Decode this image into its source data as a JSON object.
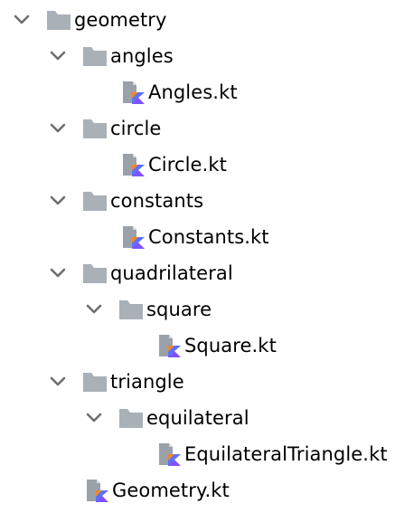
{
  "tree": {
    "root": {
      "label": "geometry",
      "icon": "folder-icon",
      "expanded": true
    },
    "items": [
      {
        "label": "angles",
        "icon": "folder-icon",
        "expanded": true
      },
      {
        "label": "Angles.kt",
        "icon": "kotlin-file-icon"
      },
      {
        "label": "circle",
        "icon": "folder-icon",
        "expanded": true
      },
      {
        "label": "Circle.kt",
        "icon": "kotlin-file-icon"
      },
      {
        "label": "constants",
        "icon": "folder-icon",
        "expanded": true
      },
      {
        "label": "Constants.kt",
        "icon": "kotlin-file-icon"
      },
      {
        "label": "quadrilateral",
        "icon": "folder-icon",
        "expanded": true
      },
      {
        "label": "square",
        "icon": "folder-icon",
        "expanded": true
      },
      {
        "label": "Square.kt",
        "icon": "kotlin-file-icon"
      },
      {
        "label": "triangle",
        "icon": "folder-icon",
        "expanded": true
      },
      {
        "label": "equilateral",
        "icon": "folder-icon",
        "expanded": true
      },
      {
        "label": "EquilateralTriangle.kt",
        "icon": "kotlin-file-icon"
      },
      {
        "label": "Geometry.kt",
        "icon": "kotlin-file-icon"
      }
    ]
  },
  "colors": {
    "folder": "#a9b0b8",
    "chevron": "#6e6e6e",
    "file_page": "#9aa1a9",
    "kotlin_orange": "#f0862e",
    "kotlin_purple": "#7f52ff",
    "kotlin_blue": "#3c8cf5"
  }
}
